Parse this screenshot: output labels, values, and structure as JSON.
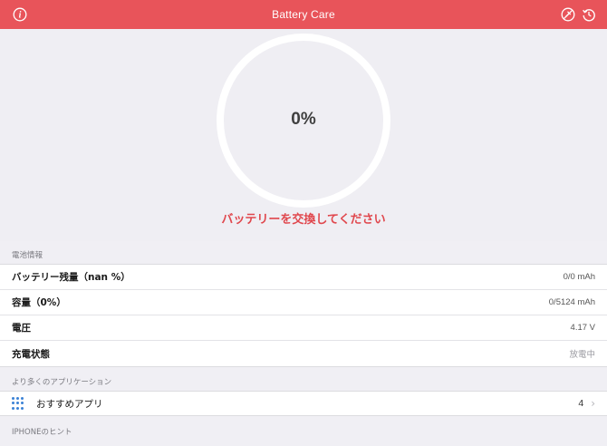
{
  "navbar": {
    "title": "Battery Care",
    "left_icon": "info-icon",
    "right_icons": [
      "no-charge-icon",
      "history-icon"
    ],
    "color": "#e8545a"
  },
  "hero": {
    "percent": "0%",
    "warning": "バッテリーを交換してください",
    "warning_color": "#e0474d"
  },
  "battery_section": {
    "header": "電池情報",
    "rows": [
      {
        "label": "バッテリー残量（nan %）",
        "value": "0/0 mAh"
      },
      {
        "label": "容量（0%）",
        "value": "0/5124 mAh"
      },
      {
        "label": "電圧",
        "value": "4.17 V"
      },
      {
        "label": "充電状態",
        "value": "放電中"
      }
    ]
  },
  "apps_section": {
    "header": "より多くのアプリケーション",
    "item_label": "おすすめアプリ",
    "item_count": "4",
    "item_icon": "app-grid-icon"
  },
  "hints_section": {
    "header": "IPHONEのヒント"
  }
}
